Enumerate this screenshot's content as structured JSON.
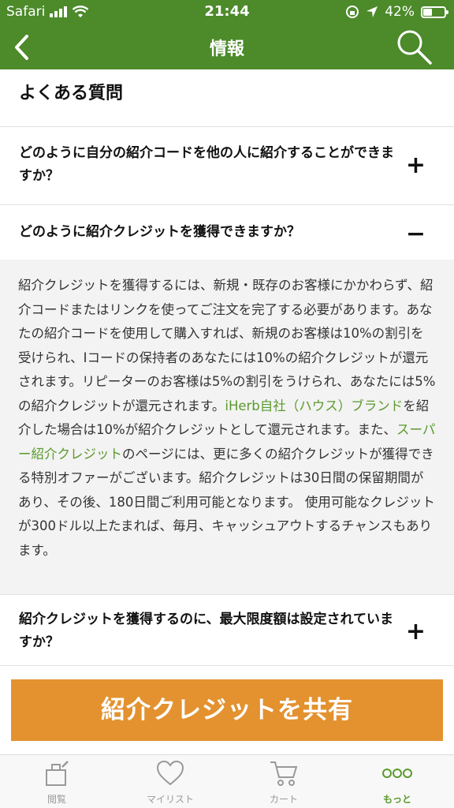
{
  "status_bar": {
    "carrier": "Safari",
    "time": "21:44",
    "battery_percent": "42%",
    "battery_level": 0.42
  },
  "nav": {
    "title": "情報",
    "back_icon": "chevron-left-icon",
    "search_icon": "search-icon"
  },
  "faq": {
    "heading": "よくある質問",
    "items": [
      {
        "question": "どのように自分の紹介コードを他の人に紹介することができますか？",
        "toggle": "+"
      },
      {
        "question": "どのように紹介クレジットを獲得できますか？",
        "toggle": "−",
        "answer": {
          "part1": "紹介クレジットを獲得するには、新規・既存のお客様にかかわらず、紹介コードまたはリンクを使ってご注文を完了する必要があります。あなたの紹介コードを使用して購入すれば、新規のお客様は10%の割引を受けられ、Iコードの保持者のあなたには10%の紹介クレジットが還元されます。リピーターのお客様は5%の割引をうけられ、あなたには5%の紹介クレジットが還元されます。",
          "link1": "iHerb自社（ハウス）ブランド",
          "part2": "を紹介した場合は10%が紹介クレジットとして還元されます。また、",
          "link2": "スーパー紹介クレジット",
          "part3": "のページには、更に多くの紹介クレジットが獲得できる特別オファーがございます。紹介クレジットは30日間の保留期間があり、その後、180日間ご利用可能となります。 使用可能なクレジットが300ドル以上たまれば、毎月、キャッシュアウトするチャンスもあります。"
        }
      },
      {
        "question": "紹介クレジットを獲得するのに、最大限度額は設定されていますか？",
        "toggle": "+"
      }
    ]
  },
  "share_button": {
    "label": "紹介クレジットを共有",
    "color": "#e3922f"
  },
  "tabs": [
    {
      "label": "閲覧",
      "icon": "browse-icon",
      "active": false
    },
    {
      "label": "マイリスト",
      "icon": "heart-icon",
      "active": false
    },
    {
      "label": "カート",
      "icon": "cart-icon",
      "active": false
    },
    {
      "label": "もっと",
      "icon": "more-dots-icon",
      "active": true
    }
  ],
  "colors": {
    "brand_green": "#4c8a2a",
    "link_green": "#5a9a2c",
    "accent_orange": "#e3922f"
  }
}
